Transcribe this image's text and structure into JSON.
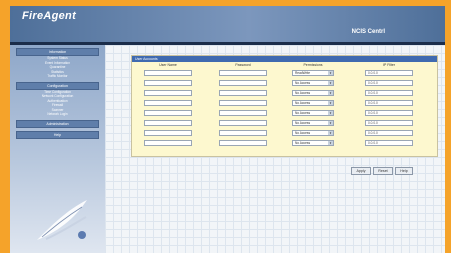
{
  "header": {
    "brand": "FireAgent",
    "product": "NCIS Centrl"
  },
  "sidebar": {
    "sections": [
      {
        "title": "Information",
        "items": [
          "System Status",
          "Event Information",
          "Quarantine",
          "Statistics",
          "Traffic Monitor"
        ]
      },
      {
        "title": "Configuration",
        "items": [
          "Time Configuration",
          "Network Configuration",
          "Authentication",
          "Firewall",
          "Scanner",
          "Network Login"
        ]
      },
      {
        "title": "Administration",
        "items": []
      },
      {
        "title": "Help",
        "items": []
      }
    ]
  },
  "panel": {
    "title": "User Accounts",
    "columns": [
      "User Name",
      "Password",
      "Permissions",
      "IP Filter"
    ],
    "rows": [
      {
        "ip": "0.0.0.0",
        "perm": "ReadWrite"
      },
      {
        "ip": "0.0.0.0",
        "perm": "No Access"
      },
      {
        "ip": "0.0.0.0",
        "perm": "No Access"
      },
      {
        "ip": "0.0.0.0",
        "perm": "No Access"
      },
      {
        "ip": "0.0.0.0",
        "perm": "No Access"
      },
      {
        "ip": "0.0.0.0",
        "perm": "No Access"
      },
      {
        "ip": "0.0.0.0",
        "perm": "No Access"
      },
      {
        "ip": "0.0.0.0",
        "perm": "No Access"
      }
    ]
  },
  "buttons": {
    "apply": "Apply",
    "reset": "Reset",
    "help": "Help"
  }
}
